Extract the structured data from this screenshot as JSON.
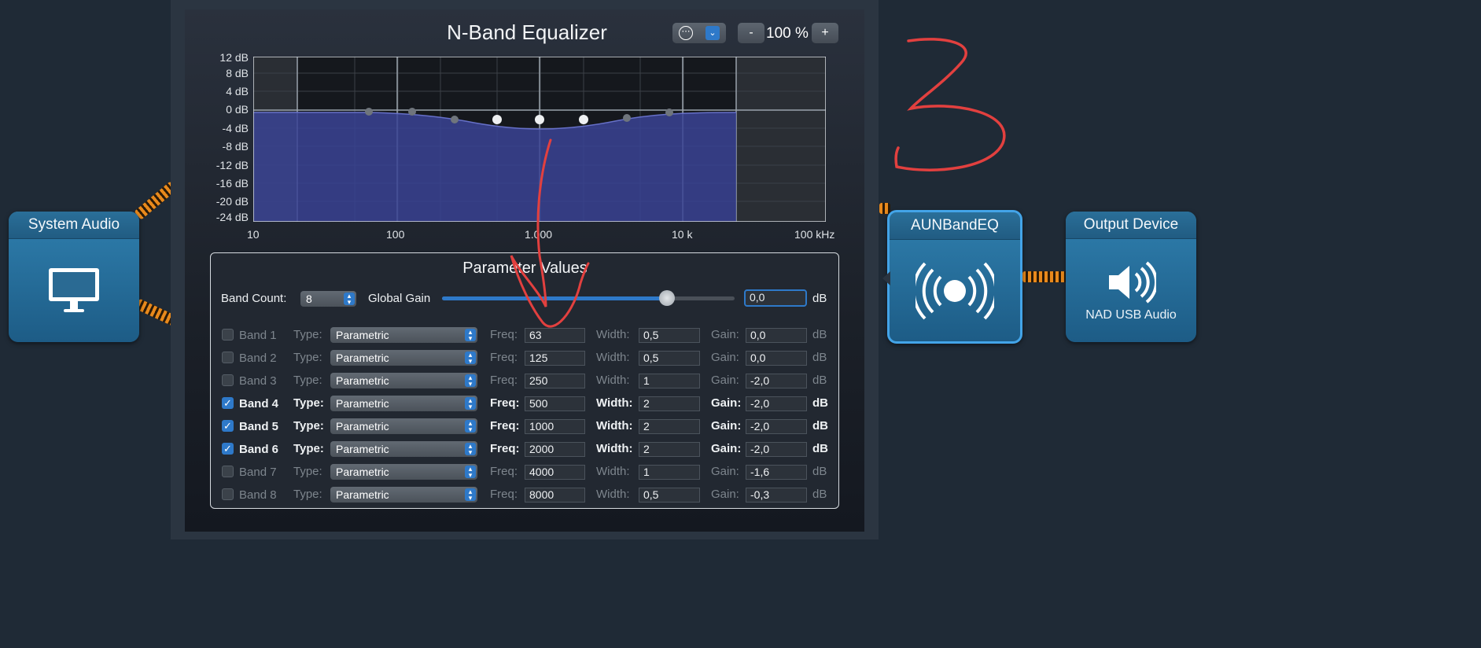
{
  "nodes": {
    "system_audio": {
      "title": "System Audio",
      "icon": "monitor-icon"
    },
    "plugin": {
      "title": "AUNBandEQ",
      "icon": "broadcast-icon"
    },
    "output": {
      "title": "Output Device",
      "subtitle": "NAD USB Audio",
      "icon": "speaker-icon"
    }
  },
  "window": {
    "title": "N-Band Equalizer",
    "preset_icon": "ellipsis-icon",
    "zoom_minus": "-",
    "zoom_value": "100 %",
    "zoom_plus": "+"
  },
  "graph": {
    "y_labels": [
      "12 dB",
      "8 dB",
      "4 dB",
      "0 dB",
      "-4 dB",
      "-8 dB",
      "-12 dB",
      "-16 dB",
      "-20 dB",
      "-24 dB"
    ],
    "x_labels": [
      "10",
      "100",
      "1.000",
      "10 k",
      "100 kHz"
    ]
  },
  "params": {
    "title": "Parameter Values",
    "band_count_label": "Band Count:",
    "band_count_value": "8",
    "global_gain_label": "Global Gain",
    "global_gain_value": "0,0",
    "global_gain_position": 0.77,
    "db_unit": "dB",
    "type_label": "Type:",
    "freq_label": "Freq:",
    "width_label": "Width:",
    "gain_label": "Gain:",
    "bands": [
      {
        "name": "Band 1",
        "enabled": false,
        "type": "Parametric",
        "freq": "63",
        "width": "0,5",
        "gain": "0,0"
      },
      {
        "name": "Band 2",
        "enabled": false,
        "type": "Parametric",
        "freq": "125",
        "width": "0,5",
        "gain": "0,0"
      },
      {
        "name": "Band 3",
        "enabled": false,
        "type": "Parametric",
        "freq": "250",
        "width": "1",
        "gain": "-2,0"
      },
      {
        "name": "Band 4",
        "enabled": true,
        "type": "Parametric",
        "freq": "500",
        "width": "2",
        "gain": "-2,0"
      },
      {
        "name": "Band 5",
        "enabled": true,
        "type": "Parametric",
        "freq": "1000",
        "width": "2",
        "gain": "-2,0"
      },
      {
        "name": "Band 6",
        "enabled": true,
        "type": "Parametric",
        "freq": "2000",
        "width": "2",
        "gain": "-2,0"
      },
      {
        "name": "Band 7",
        "enabled": false,
        "type": "Parametric",
        "freq": "4000",
        "width": "1",
        "gain": "-1,6"
      },
      {
        "name": "Band 8",
        "enabled": false,
        "type": "Parametric",
        "freq": "8000",
        "width": "0,5",
        "gain": "-0,3"
      }
    ]
  },
  "annotation": {
    "handwritten": "3"
  }
}
